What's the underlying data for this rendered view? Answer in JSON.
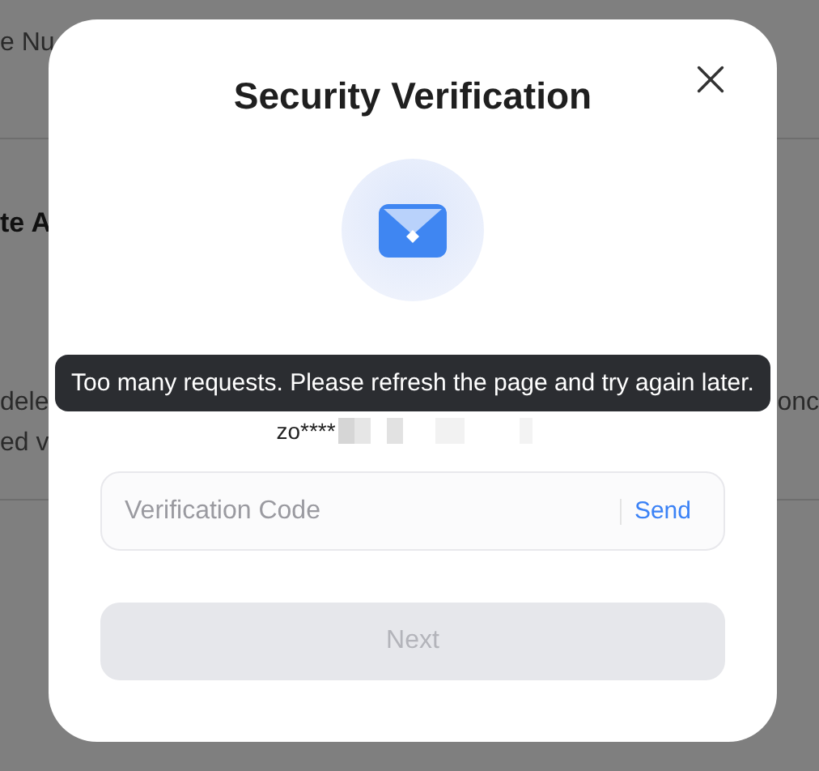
{
  "background_page": {
    "heading_1": "e Nu",
    "heading_2": "te A",
    "text_left_1": "dele",
    "text_left_2": "ed v",
    "text_right": "onc"
  },
  "dialog": {
    "title": "Security Verification",
    "masked_account": "zo****",
    "code_field": {
      "placeholder": "Verification Code",
      "action": "Send"
    },
    "next_button": {
      "label": "Next",
      "disabled": true
    }
  },
  "tooltip": {
    "text": "Too many requests. Please refresh the page and try again later."
  }
}
